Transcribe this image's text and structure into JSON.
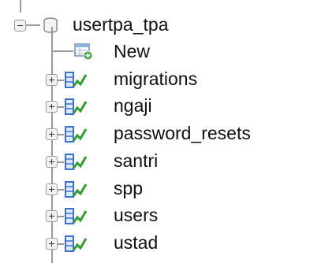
{
  "database": {
    "name": "usertpa_tpa",
    "icon": "database-icon"
  },
  "new_item": {
    "label": "New",
    "icon": "new-table-icon"
  },
  "tables": [
    {
      "name": "migrations",
      "icon": "table-structure-icon"
    },
    {
      "name": "ngaji",
      "icon": "table-structure-icon"
    },
    {
      "name": "password_resets",
      "icon": "table-structure-icon"
    },
    {
      "name": "santri",
      "icon": "table-structure-icon"
    },
    {
      "name": "spp",
      "icon": "table-structure-icon"
    },
    {
      "name": "users",
      "icon": "table-structure-icon"
    },
    {
      "name": "ustad",
      "icon": "table-structure-icon"
    }
  ],
  "colors": {
    "tree_line": "#9a9a9a",
    "table_icon_blue": "#3a6fd6",
    "table_icon_green": "#2f9f2f",
    "new_icon_green": "#3fa33f"
  }
}
